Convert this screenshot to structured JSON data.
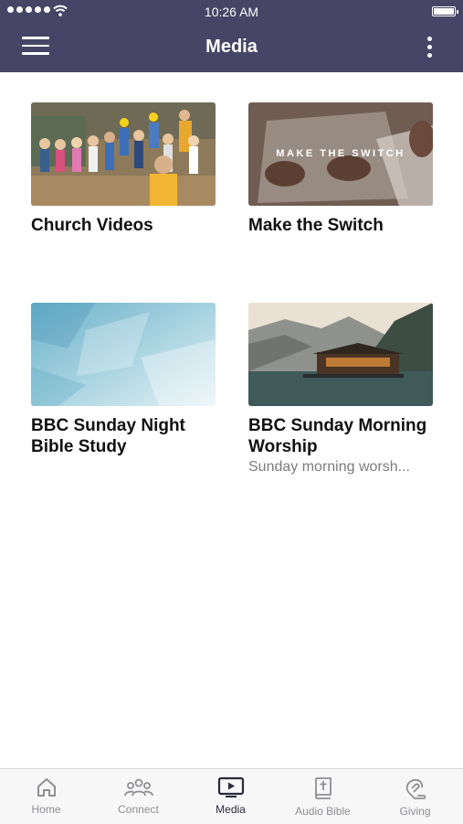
{
  "status_bar": {
    "time": "10:26 AM"
  },
  "header": {
    "title": "Media"
  },
  "colors": {
    "header_bg": "#474565",
    "active_tab": "#2a2a3a",
    "inactive_tab": "#8e8e93"
  },
  "media_items": [
    {
      "title": "Church Videos",
      "thumbnail": "children-on-stage-photo"
    },
    {
      "title": "Make the Switch",
      "thumbnail": "laptop-typing-photo",
      "overlay_text": "MAKE THE SWITCH"
    },
    {
      "title": "BBC Sunday Night Bible Study",
      "thumbnail": "blue-texture-photo"
    },
    {
      "title": "BBC Sunday Morning Worship",
      "subtitle": "Sunday morning worsh...",
      "thumbnail": "lake-mountain-cabin-photo"
    }
  ],
  "tabs": [
    {
      "label": "Home",
      "icon": "home-icon"
    },
    {
      "label": "Connect",
      "icon": "people-icon"
    },
    {
      "label": "Media",
      "icon": "tv-play-icon",
      "active": true
    },
    {
      "label": "Audio Bible",
      "icon": "bible-icon"
    },
    {
      "label": "Giving",
      "icon": "giving-icon"
    }
  ]
}
